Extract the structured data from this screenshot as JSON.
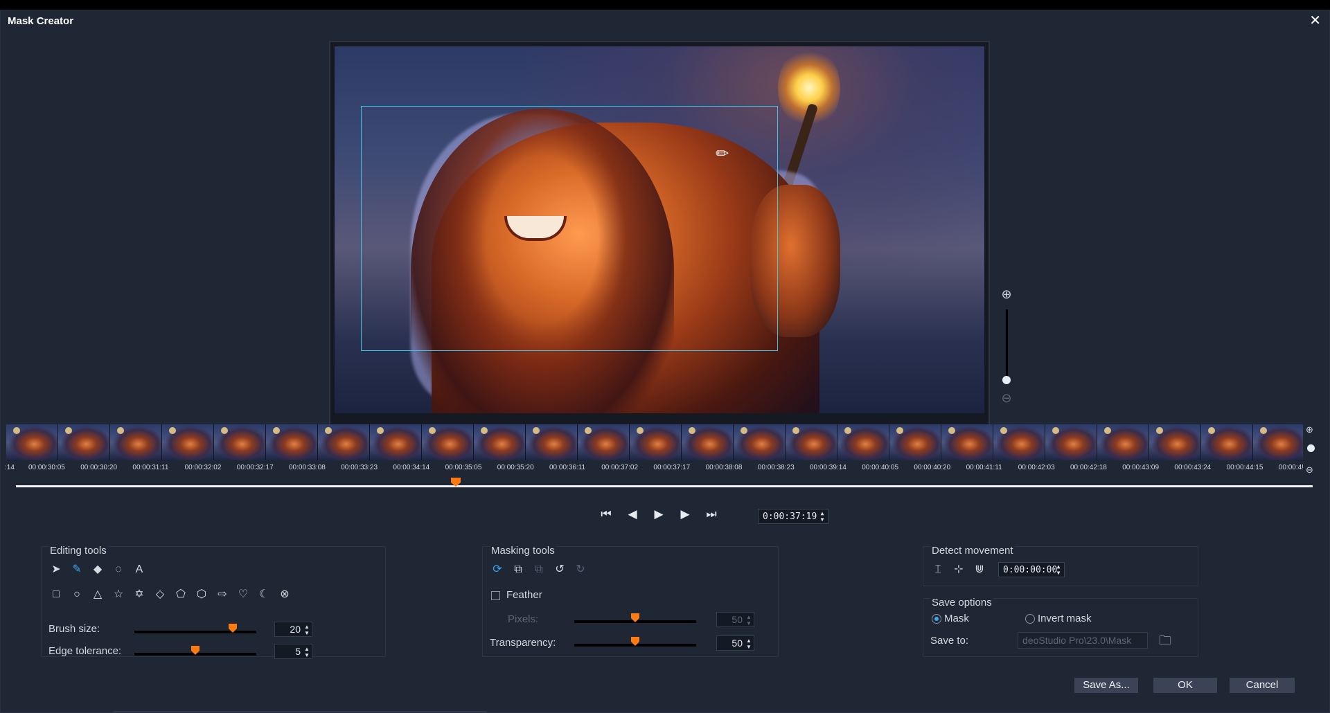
{
  "window": {
    "title": "Mask Creator",
    "close": "✕"
  },
  "preview": {},
  "timeline": {
    "timecodes": [
      ":14",
      "00:00:30:05",
      "00:00:30:20",
      "00:00:31:11",
      "00:00:32:02",
      "00:00:32:17",
      "00:00:33:08",
      "00:00:33:23",
      "00:00:34:14",
      "00:00:35:05",
      "00:00:35:20",
      "00:00:36:11",
      "00:00:37:02",
      "00:00:37:17",
      "00:00:38:08",
      "00:00:38:23",
      "00:00:39:14",
      "00:00:40:05",
      "00:00:40:20",
      "00:00:41:11",
      "00:00:42:03",
      "00:00:42:18",
      "00:00:43:09",
      "00:00:43:24",
      "00:00:44:15",
      "00:00:4!"
    ],
    "current_timecode": "0:00:37:19"
  },
  "editing_tools": {
    "title": "Editing tools",
    "brush_size_label": "Brush size:",
    "brush_size_value": "20",
    "edge_tolerance_label": "Edge tolerance:",
    "edge_tolerance_value": "5"
  },
  "masking_tools": {
    "title": "Masking tools",
    "feather_label": "Feather",
    "feather_checked": false,
    "pixels_label": "Pixels:",
    "pixels_value": "50",
    "transparency_label": "Transparency:",
    "transparency_value": "50"
  },
  "detect_movement": {
    "title": "Detect movement",
    "timecode": "0:00:00:00"
  },
  "save_options": {
    "title": "Save options",
    "mask_label": "Mask",
    "invert_label": "Invert mask",
    "selected": "Mask",
    "save_to_label": "Save to:",
    "save_to_path": "deoStudio Pro\\23.0\\Mask"
  },
  "buttons": {
    "save_as": "Save As...",
    "ok": "OK",
    "cancel": "Cancel"
  },
  "colors": {
    "accent": "#3aa7f0",
    "slider_thumb": "#ff7a10",
    "bbox": "#35c6e8"
  }
}
